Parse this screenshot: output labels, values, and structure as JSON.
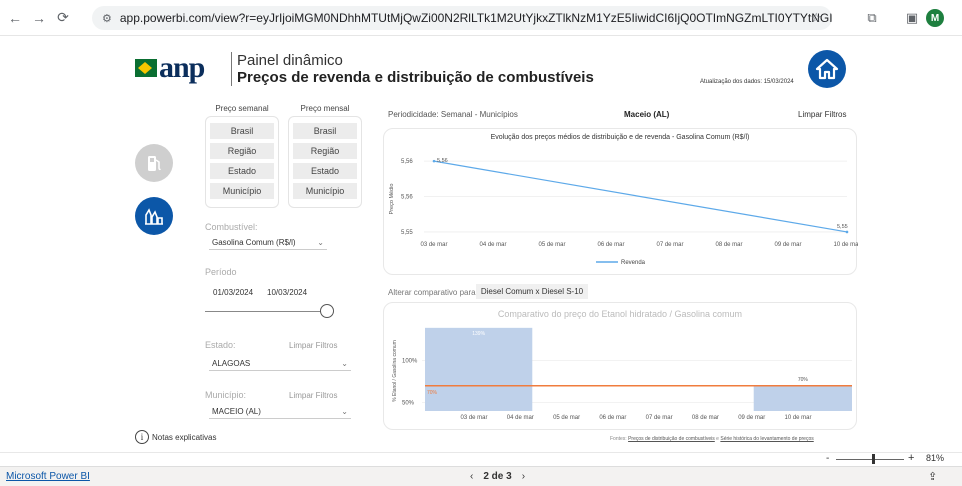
{
  "browser": {
    "url": "app.powerbi.com/view?r=eyJrIjoiMGM0NDhhMTUtMjQwZi00N2RlLTk1M2UtYjkxZTlkNzM1YzE5IiwidCI6IjQ0OTImNGZmLTI0YTYtNGI0Mi1iN2VmLTEyNGFmY2FkY...",
    "avatar_letter": "M"
  },
  "header": {
    "logo_text": "anp",
    "title_line1": "Painel dinâmico",
    "title_line2": "Preços de revenda e distribuição de combustíveis",
    "update_text": "Atualização dos dados: 15/03/2024"
  },
  "filters": {
    "semanal_header": "Preço semanal",
    "mensal_header": "Preço mensal",
    "semanal_buttons": [
      "Brasil",
      "Região",
      "Estado",
      "Município"
    ],
    "mensal_buttons": [
      "Brasil",
      "Região",
      "Estado",
      "Município"
    ],
    "combustivel_label": "Combustível:",
    "combustivel_value": "Gasolina Comum (R$/l)",
    "periodo_label": "Período",
    "date_start": "01/03/2024",
    "date_end": "10/03/2024",
    "estado_label": "Estado:",
    "estado_value": "ALAGOAS",
    "municipio_label": "Município:",
    "municipio_value": "MACEIO (AL)",
    "limpar_filtros": "Limpar Filtros",
    "notas": "Notas explicativas"
  },
  "top_info": {
    "periodicidade": "Periodicidade: Semanal - Municípios",
    "location": "Maceio (AL)",
    "limpar": "Limpar Filtros"
  },
  "chart1": {
    "title": "Evolução dos preços médios de distribuição e de revenda - Gasolina Comum (R$/l)",
    "ylabel": "Preço Médio",
    "legend": "Revenda",
    "color": "#5da9e9"
  },
  "comparativo": {
    "alterar_label": "Alterar comparativo para:",
    "diesel_btn": "Diesel Comum x Diesel S-10"
  },
  "chart2": {
    "title": "Comparativo do preço do Etanol hidratado / Gasolina comum",
    "ylabel": "% Etanol / Gasolina comum",
    "bar_color": "#bfd1ea",
    "line_color": "#f07c3e"
  },
  "fontes": {
    "prefix": "Fontes: ",
    "link1": "Preços de distribuição de combustíveis",
    "mid": " e ",
    "link2": "Série histórica do levantamento de preços"
  },
  "zoom": {
    "percent": "81%"
  },
  "pbi": {
    "link": "Microsoft Power BI",
    "pager": "2 de 3"
  },
  "chart_data": [
    {
      "type": "line",
      "title": "Evolução dos preços médios de distribuição e de revenda - Gasolina Comum (R$/l)",
      "ylabel": "Preço Médio",
      "categories": [
        "03 de mar",
        "04 de mar",
        "05 de mar",
        "06 de mar",
        "07 de mar",
        "08 de mar",
        "09 de mar",
        "10 de mar"
      ],
      "y_ticks": [
        "5,55",
        "5,56",
        "5,56"
      ],
      "ylim": [
        5.548,
        5.565
      ],
      "series": [
        {
          "name": "Revenda",
          "x": [
            "03 de mar",
            "10 de mar"
          ],
          "values": [
            5.563,
            5.549
          ],
          "labels": [
            "5,56",
            "5,55"
          ]
        }
      ],
      "legend": "bottom-center",
      "grid": true
    },
    {
      "type": "bar",
      "title": "Comparativo do preço do Etanol hidratado / Gasolina comum",
      "ylabel": "% Etanol / Gasolina comum",
      "categories": [
        "03 de mar",
        "04 de mar",
        "05 de mar",
        "06 de mar",
        "07 de mar",
        "08 de mar",
        "09 de mar",
        "10 de mar"
      ],
      "y_ticks": [
        "50%",
        "100%"
      ],
      "ylim": [
        40,
        140
      ],
      "bars": [
        {
          "from": "03 de mar",
          "to": "04 de mar",
          "value": 139,
          "label": "139%"
        },
        {
          "from": "09 de mar",
          "to": "10 de mar",
          "value": 70,
          "label": "70%"
        }
      ],
      "reference_line": {
        "value": 70,
        "label": "70%"
      },
      "grid": true
    }
  ]
}
